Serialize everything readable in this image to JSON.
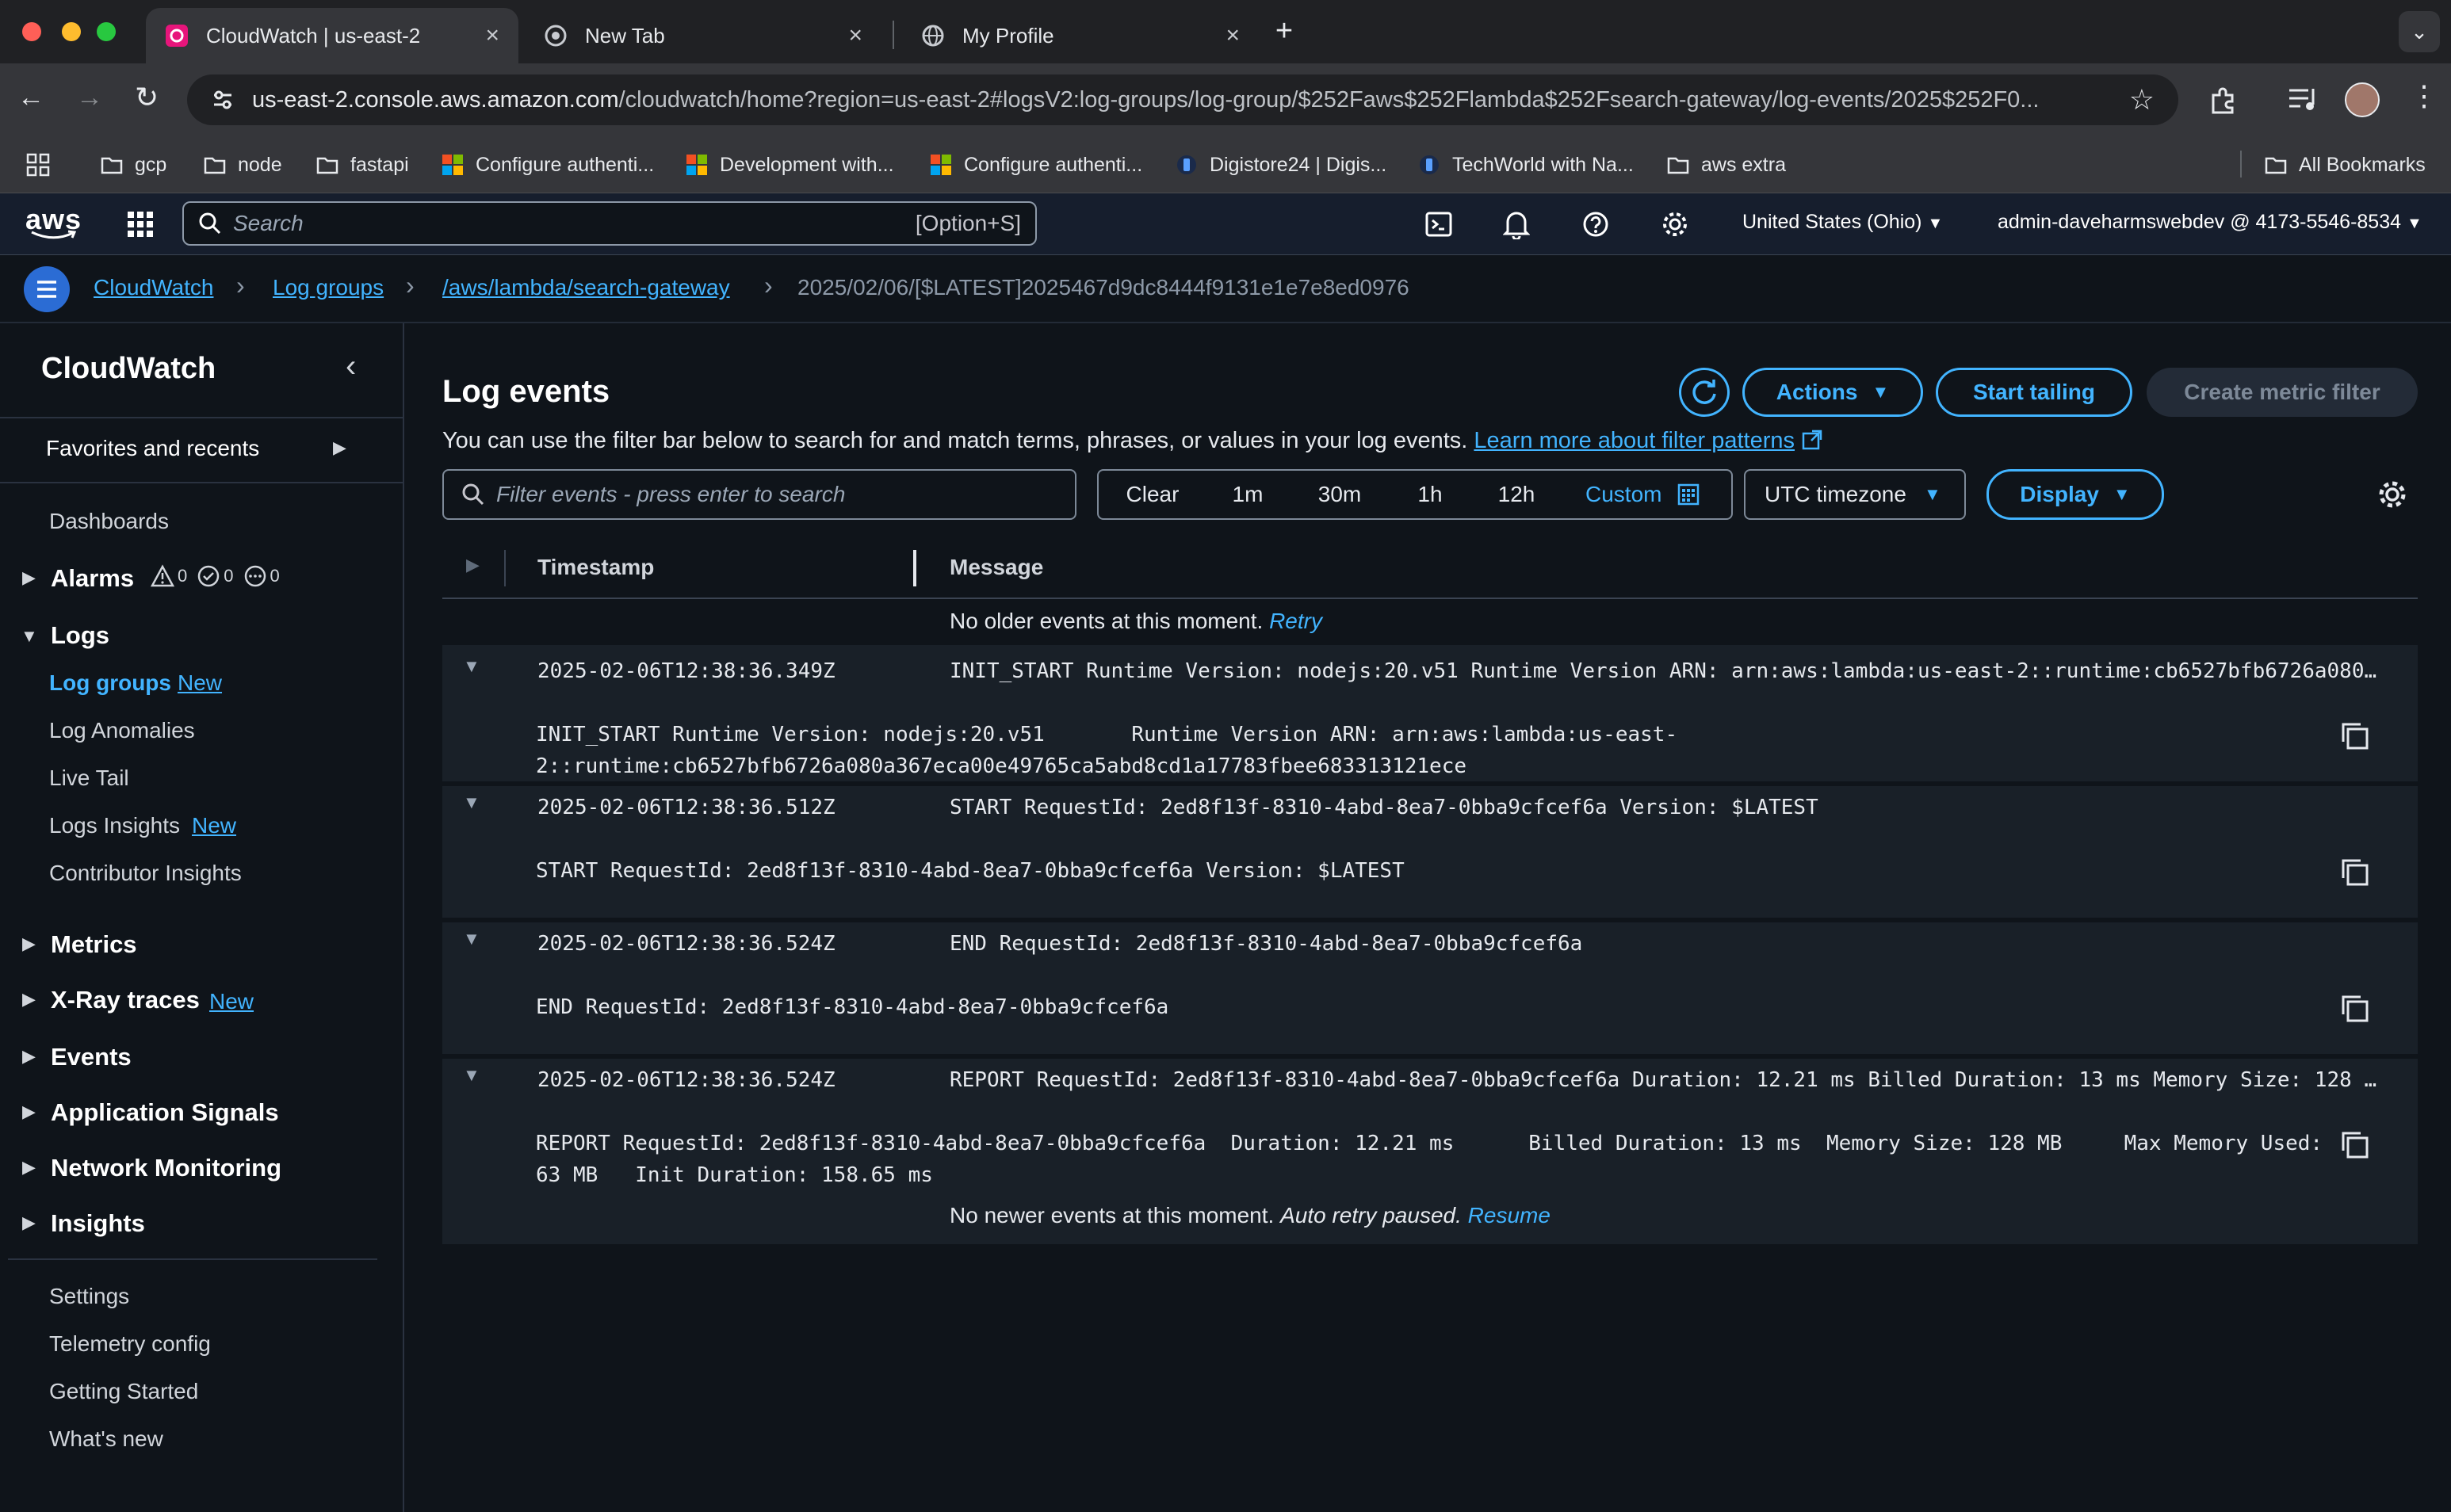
{
  "browser": {
    "tabs": [
      {
        "title": "CloudWatch | us-east-2",
        "active": true,
        "icon": "cloudwatch-favicon"
      },
      {
        "title": "New Tab",
        "active": false,
        "icon": "chrome-icon"
      },
      {
        "title": "My Profile",
        "active": false,
        "icon": "globe-icon"
      }
    ],
    "url_host": "us-east-2.console.aws.amazon.com",
    "url_path": "/cloudwatch/home?region=us-east-2#logsV2:log-groups/log-group/$252Faws$252Flambda$252Fsearch-gateway/log-events/2025$252F0...",
    "bookmarks": [
      "gcp",
      "node",
      "fastapi",
      "Configure authenti...",
      "Development with...",
      "Configure authenti...",
      "Digistore24 | Digis...",
      "TechWorld with Na...",
      "aws extra"
    ],
    "all_bookmarks": "All Bookmarks"
  },
  "aws_nav": {
    "logo": "aws",
    "search_placeholder": "Search",
    "search_shortcut": "[Option+S]",
    "region": "United States (Ohio)",
    "account": "admin-daveharmswebdev @ 4173-5546-8534"
  },
  "breadcrumb": {
    "items": [
      "CloudWatch",
      "Log groups",
      "/aws/lambda/search-gateway"
    ],
    "current": "2025/02/06/[$LATEST]2025467d9dc8444f9131e1e7e8ed0976"
  },
  "sidebar": {
    "title": "CloudWatch",
    "favorites": "Favorites and recents",
    "dashboards": "Dashboards",
    "alarms": {
      "label": "Alarms",
      "alarm_count": "0",
      "ok_count": "0",
      "insufficient_count": "0"
    },
    "logs": {
      "label": "Logs",
      "items": [
        {
          "label": "Log groups",
          "tag": "New"
        },
        {
          "label": "Log Anomalies",
          "tag": ""
        },
        {
          "label": "Live Tail",
          "tag": ""
        },
        {
          "label": "Logs Insights",
          "tag": "New"
        },
        {
          "label": "Contributor Insights",
          "tag": ""
        }
      ]
    },
    "groups": [
      {
        "label": "Metrics",
        "tag": ""
      },
      {
        "label": "X-Ray traces",
        "tag": "New"
      },
      {
        "label": "Events",
        "tag": ""
      },
      {
        "label": "Application Signals",
        "tag": ""
      },
      {
        "label": "Network Monitoring",
        "tag": ""
      },
      {
        "label": "Insights",
        "tag": ""
      }
    ],
    "footer": [
      "Settings",
      "Telemetry config",
      "Getting Started",
      "What's new"
    ]
  },
  "main": {
    "title": "Log events",
    "description": "You can use the filter bar below to search for and match terms, phrases, or values in your log events.",
    "learn_more": "Learn more about filter patterns",
    "buttons": {
      "actions": "Actions",
      "start_tailing": "Start tailing",
      "create_metric_filter": "Create metric filter"
    },
    "filter_placeholder": "Filter events - press enter to search",
    "time_ranges": [
      "Clear",
      "1m",
      "30m",
      "1h",
      "12h",
      "Custom"
    ],
    "timezone": "UTC timezone",
    "display": "Display",
    "columns": {
      "timestamp": "Timestamp",
      "message": "Message"
    },
    "no_older": "No older events at this moment.",
    "retry": "Retry",
    "no_newer": "No newer events at this moment.",
    "auto_retry": "Auto retry paused.",
    "resume": "Resume",
    "events": [
      {
        "timestamp": "2025-02-06T12:38:36.349Z",
        "message": "INIT_START Runtime Version: nodejs:20.v51 Runtime Version ARN: arn:aws:lambda:us-east-2::runtime:cb6527bfb6726a080a367eca00e...",
        "detail_lines": [
          "INIT_START Runtime Version: nodejs:20.v51       Runtime Version ARN: arn:aws:lambda:us-east-",
          "2::runtime:cb6527bfb6726a080a367eca00e49765ca5abd8cd1a17783fbee683313121ece"
        ]
      },
      {
        "timestamp": "2025-02-06T12:38:36.512Z",
        "message": "START RequestId: 2ed8f13f-8310-4abd-8ea7-0bba9cfcef6a Version: $LATEST",
        "detail_lines": [
          "START RequestId: 2ed8f13f-8310-4abd-8ea7-0bba9cfcef6a Version: $LATEST"
        ]
      },
      {
        "timestamp": "2025-02-06T12:38:36.524Z",
        "message": "END RequestId: 2ed8f13f-8310-4abd-8ea7-0bba9cfcef6a",
        "detail_lines": [
          "END RequestId: 2ed8f13f-8310-4abd-8ea7-0bba9cfcef6a"
        ]
      },
      {
        "timestamp": "2025-02-06T12:38:36.524Z",
        "message": "REPORT RequestId: 2ed8f13f-8310-4abd-8ea7-0bba9cfcef6a Duration: 12.21 ms Billed Duration: 13 ms Memory Size: 128 MB Max Mem...",
        "detail_lines": [
          "REPORT RequestId: 2ed8f13f-8310-4abd-8ea7-0bba9cfcef6a  Duration: 12.21 ms      Billed Duration: 13 ms  Memory Size: 128 MB     Max Memory Used:",
          "63 MB   Init Duration: 158.65 ms"
        ]
      }
    ]
  },
  "colors": {
    "link": "#42b4ff",
    "background": "#0f141a",
    "row": "#192028",
    "aws_nav": "#161e2d"
  }
}
